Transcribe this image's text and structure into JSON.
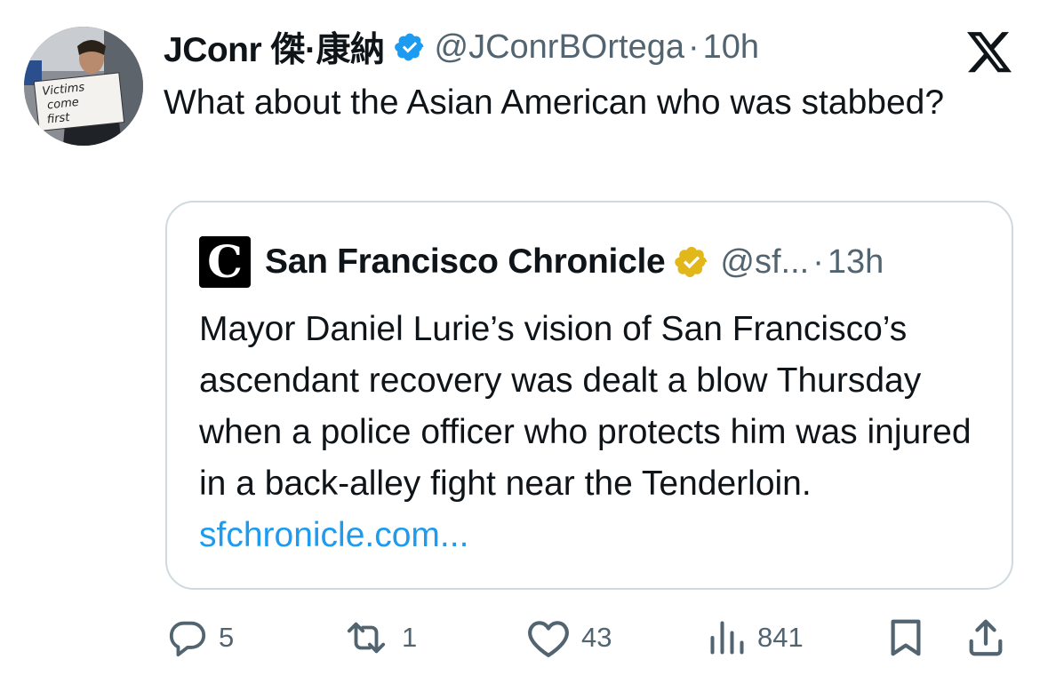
{
  "author": {
    "display_name": "JConr 傑·康納",
    "handle": "@JConrBOrtega",
    "separator": "·",
    "time": "10h",
    "avatar_sign_text": "Victims come first"
  },
  "tweet": {
    "text": "What about the Asian American who was stabbed?"
  },
  "quoted": {
    "logo_letter": "C",
    "name": "San Francisco Chronicle",
    "handle": "@sf...",
    "separator": "·",
    "time": "13h",
    "text": "Mayor Daniel Lurie’s vision of San Francisco’s ascendant recovery was dealt a blow Thursday when a police officer who protects him was injured in a back-alley fight near the Tenderloin. ",
    "link_text": "sfchronicle.com..."
  },
  "actions": {
    "replies": "5",
    "reposts": "1",
    "likes": "43",
    "views": "841"
  },
  "icons": {
    "verified_blue": "verified-badge-blue",
    "verified_gold": "verified-badge-gold",
    "platform": "x-logo",
    "reply": "reply-icon",
    "repost": "repost-icon",
    "like": "heart-icon",
    "views": "views-icon",
    "bookmark": "bookmark-icon",
    "share": "share-icon"
  },
  "colors": {
    "text": "#0f1419",
    "secondary": "#536471",
    "link": "#1d9bf0",
    "verified_blue": "#1d9bf0",
    "verified_gold": "#e2b719",
    "border": "#cfd9de"
  }
}
